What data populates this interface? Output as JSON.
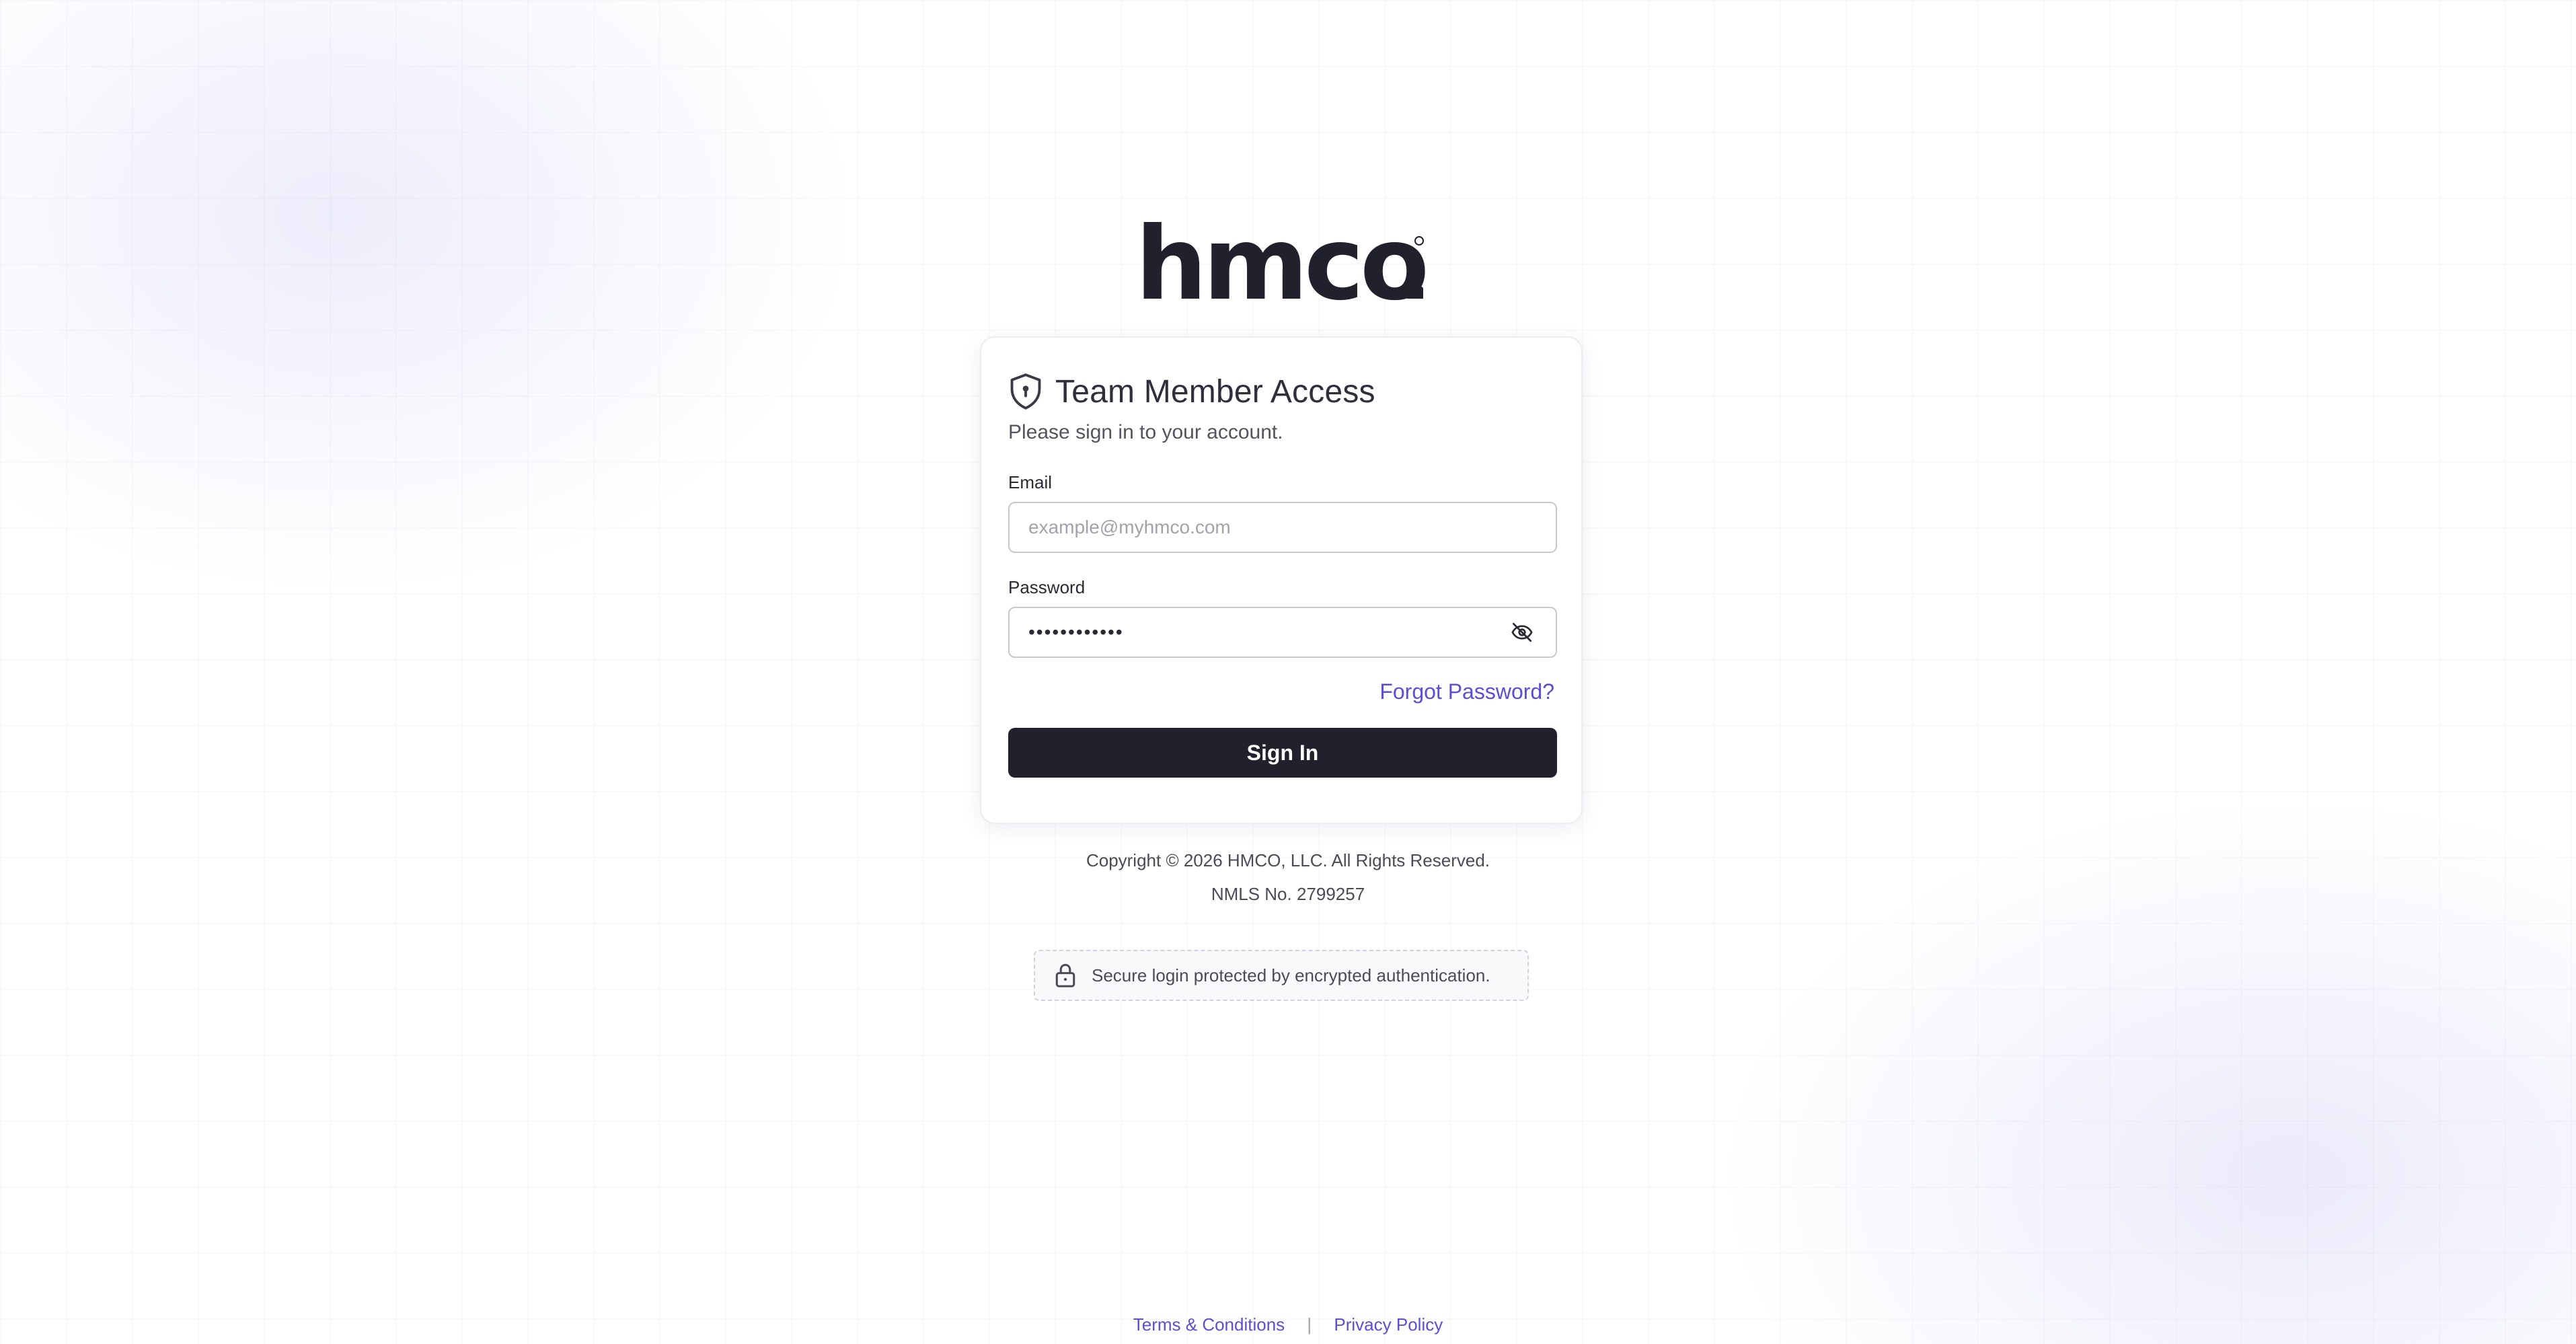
{
  "brand": {
    "logo_text": "hmco",
    "logo_color": "#21212d"
  },
  "card": {
    "title": "Team Member Access",
    "subtitle": "Please sign in to your account.",
    "icon": "shield-lock-icon"
  },
  "form": {
    "email_label": "Email",
    "email_placeholder": "example@myhmco.com",
    "email_value": "",
    "password_label": "Password",
    "password_value": "••••••••••••",
    "password_toggle_icon": "eye-off-icon",
    "forgot_password_label": "Forgot Password?",
    "sign_in_label": "Sign In"
  },
  "footer": {
    "copyright": "Copyright © 2026 HMCO, LLC. All Rights Reserved.",
    "nmls": "NMLS No. 2799257",
    "secure_note": "Secure login protected by encrypted authentication.",
    "secure_icon": "lock-icon",
    "links": {
      "terms": "Terms & Conditions",
      "separator": "|",
      "privacy": "Privacy Policy"
    }
  },
  "colors": {
    "accent": "#5b4fd3",
    "button": "#21212d",
    "text": "#2f2f3b"
  }
}
